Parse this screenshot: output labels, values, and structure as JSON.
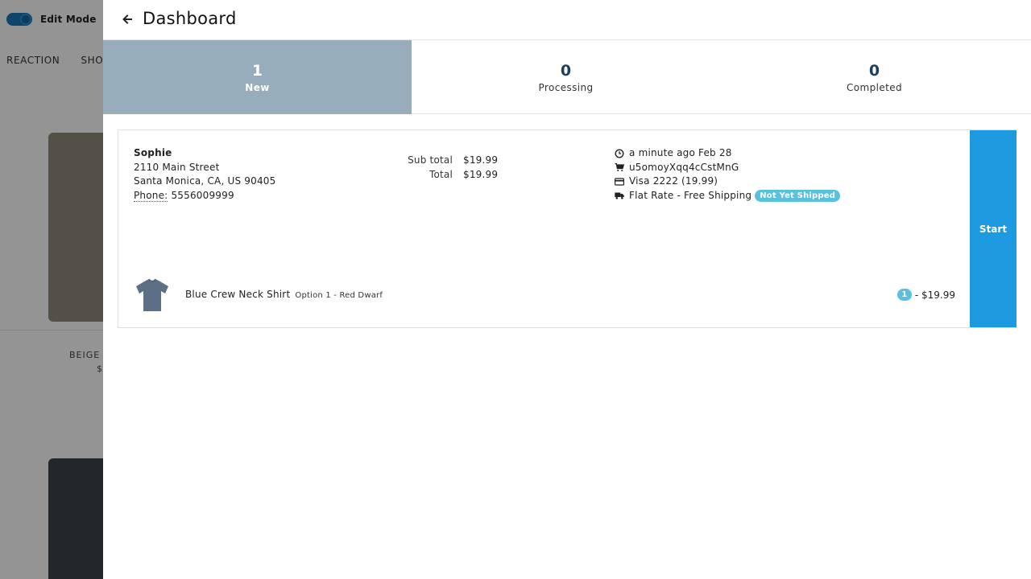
{
  "background": {
    "edit_mode_label": "Edit Mode",
    "nav_items": [
      "REACTION",
      "SHOR"
    ],
    "product_name": "BEIGE C",
    "product_price": "$"
  },
  "header": {
    "title": "Dashboard",
    "back_icon": "arrow-left-icon"
  },
  "status_tabs": [
    {
      "count": "1",
      "label": "New",
      "active": true
    },
    {
      "count": "0",
      "label": "Processing",
      "active": false
    },
    {
      "count": "0",
      "label": "Completed",
      "active": false
    }
  ],
  "order": {
    "customer": {
      "name": "Sophie",
      "street": "2110 Main Street",
      "city_line": "Santa Monica, CA, US 90405",
      "phone_label": "Phone:",
      "phone": "5556009999"
    },
    "totals": {
      "subtotal_label": "Sub total",
      "subtotal": "$19.99",
      "total_label": "Total",
      "total": "$19.99"
    },
    "meta": {
      "time": "a minute ago Feb 28",
      "cart_id": "u5omoyXqq4cCstMnG",
      "payment": "Visa 2222 (19.99)",
      "shipping": "Flat Rate - Free Shipping",
      "shipping_status": "Not Yet Shipped"
    },
    "items": [
      {
        "title": "Blue Crew Neck Shirt",
        "variant": "Option 1 - Red Dwarf",
        "quantity": "1",
        "price": "- $19.99"
      }
    ],
    "start_label": "Start"
  },
  "colors": {
    "active_tab": "#97adbb",
    "accent": "#1e9be0",
    "badge": "#5bc0de",
    "count_text": "#1d3f5e"
  }
}
